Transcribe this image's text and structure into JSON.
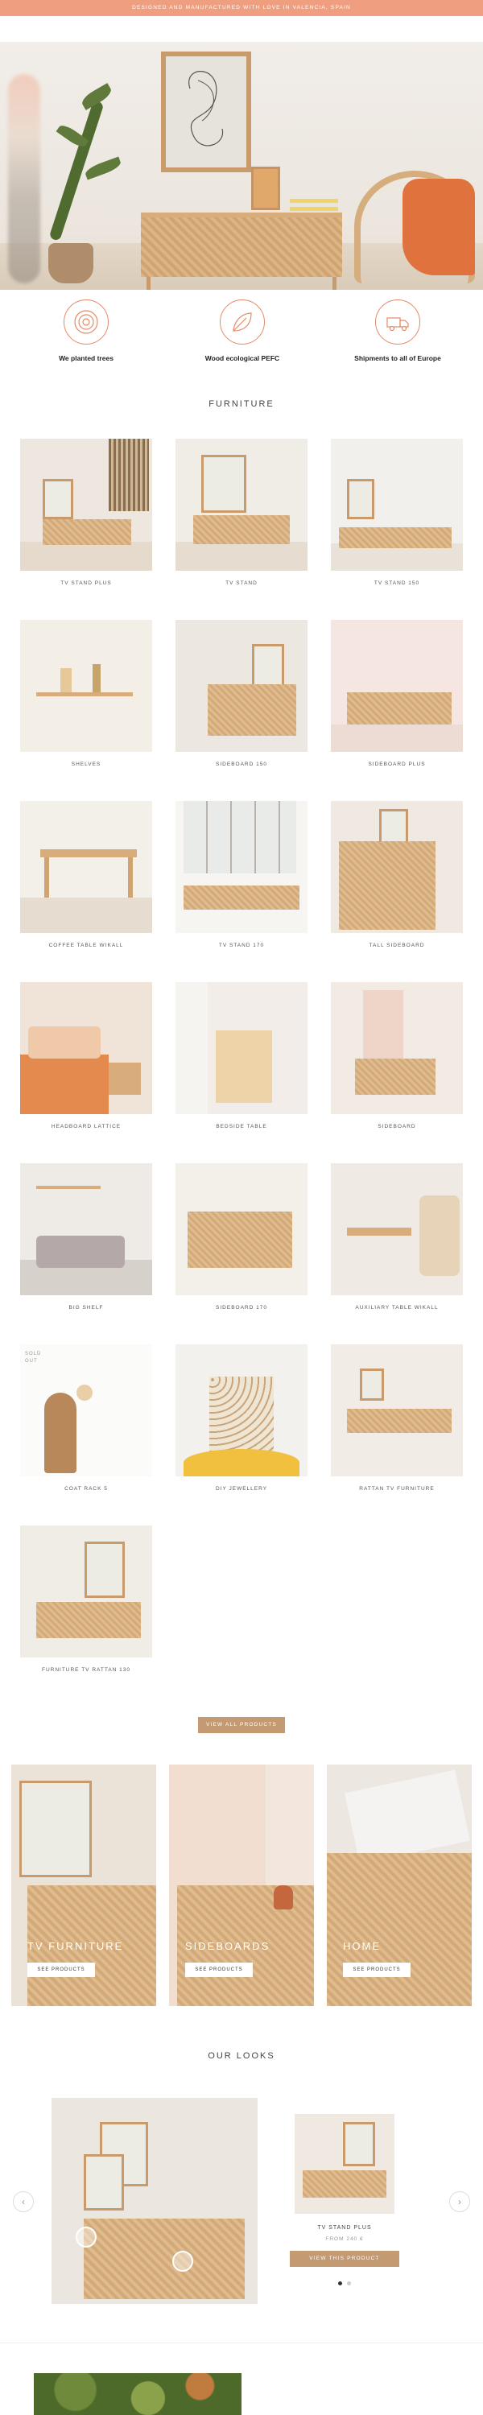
{
  "topbar": {
    "text": "DESIGNED AND MANUFACTURED WITH LOVE IN VALENCIA, SPAIN"
  },
  "features": [
    {
      "icon": "tree-rings-icon",
      "label": "We planted trees"
    },
    {
      "icon": "eco-leaf-icon",
      "label": "Wood ecological PEFC"
    },
    {
      "icon": "shipping-truck-icon",
      "label": "Shipments to all of Europe"
    }
  ],
  "furniture": {
    "title": "FURNITURE",
    "products": [
      {
        "name": "TV STAND PLUS"
      },
      {
        "name": "TV STAND"
      },
      {
        "name": "TV STAND 150"
      },
      {
        "name": "SHELVES"
      },
      {
        "name": "SIDEBOARD 150"
      },
      {
        "name": "SIDEBOARD PLUS"
      },
      {
        "name": "COFFEE TABLE WIKALL"
      },
      {
        "name": "TV STAND 170"
      },
      {
        "name": "TALL SIDEBOARD"
      },
      {
        "name": "HEADBOARD LATTICE"
      },
      {
        "name": "BEDSIDE TABLE"
      },
      {
        "name": "SIDEBOARD"
      },
      {
        "name": "BIG SHELF"
      },
      {
        "name": "SIDEBOARD 170"
      },
      {
        "name": "AUXILIARY TABLE WIKALL"
      },
      {
        "name": "COAT RACK 5",
        "badge": "SOLD OUT"
      },
      {
        "name": "DIY JEWELLERY"
      },
      {
        "name": "RATTAN TV FURNITURE"
      },
      {
        "name": "FURNITURE TV RATTAN 130"
      }
    ],
    "view_all_label": "VIEW ALL PRODUCTS"
  },
  "categories": [
    {
      "name": "TV FURNITURE",
      "button": "SEE PRODUCTS"
    },
    {
      "name": "SIDEBOARDS",
      "button": "SEE PRODUCTS"
    },
    {
      "name": "HOME",
      "button": "SEE PRODUCTS"
    }
  ],
  "looks": {
    "title": "OUR LOOKS",
    "product_name": "TV STAND PLUS",
    "product_price": "FROM 240 €",
    "button_label": "VIEW THIS PRODUCT",
    "prev_glyph": "‹",
    "next_glyph": "›"
  },
  "colors": {
    "accent": "#ef9f80",
    "tan_button": "#c49a73",
    "wood": "#d8ad7b",
    "icon_stroke": "#e48a67"
  }
}
